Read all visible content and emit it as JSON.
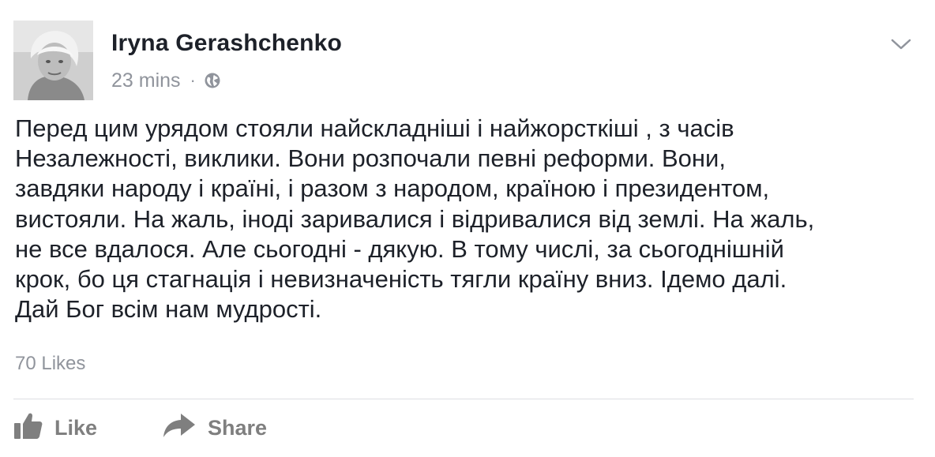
{
  "post": {
    "author": "Iryna Gerashchenko",
    "time": "23 mins",
    "separator": "·",
    "privacy_icon": "globe-icon",
    "menu_icon": "chevron-down-icon",
    "text": "Перед цим урядом стояли найскладніші і найжорсткіші , з часів\nНезалежності, виклики. Вони розпочали певні реформи. Вони,\nзавдяки народу і країні, і разом з народом, країною і президентом,\nвистояли. На жаль, іноді заривалися і відривалися від землі. На жаль,\nне все вдалося. Але сьогодні - дякую. В тому числі, за сьогоднішній\nкрок, бо ця стагнація і невизначеність тягли країну вниз. Ідемо далі.\nДай Бог всім нам мудрості.",
    "likes": "70 Likes"
  },
  "actions": {
    "like_label": "Like",
    "like_icon": "thumbs-up-icon",
    "share_label": "Share",
    "share_icon": "share-arrow-icon"
  },
  "colors": {
    "text": "#1d2129",
    "secondary": "#90949c",
    "action": "#7f7f7f",
    "divider": "#dddfe2"
  }
}
